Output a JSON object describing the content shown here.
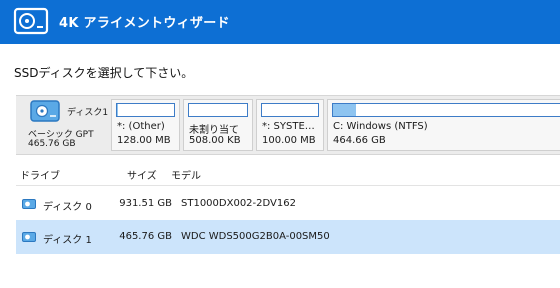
{
  "window": {
    "title": "4K アライメントウィザード"
  },
  "prompt": "SSDディスクを選択して下さい。",
  "disk": {
    "name": "ディスク1",
    "type": "ベーシック GPT",
    "size": "465.76 GB"
  },
  "partitions": [
    {
      "label": "*: (Other)",
      "size": "128.00 MB",
      "fill": 0.02
    },
    {
      "label": "未割り当て",
      "size": "508.00 KB",
      "fill": 0.0
    },
    {
      "label": "*: SYSTE…",
      "size": "100.00 MB",
      "fill": 0.0
    },
    {
      "label": "C: Windows (NTFS)",
      "size": "464.66 GB",
      "fill": 0.1
    }
  ],
  "table": {
    "headers": [
      "ドライブ",
      "サイズ",
      "モデル"
    ],
    "rows": [
      {
        "drive": "ディスク 0",
        "size": "931.51 GB",
        "model": "ST1000DX002-2DV162",
        "selected": false
      },
      {
        "drive": "ディスク 1",
        "size": "465.76 GB",
        "model": "WDC WDS500G2B0A-00SM50",
        "selected": true
      }
    ]
  },
  "colors": {
    "titlebar": "#0d6fd4",
    "selection": "#cce4fb",
    "bar_border": "#3d7cc7",
    "bar_fill": "#8ec4f0"
  },
  "icons": {
    "app": "disk-drive-icon",
    "disk": "disk-drive-icon"
  }
}
